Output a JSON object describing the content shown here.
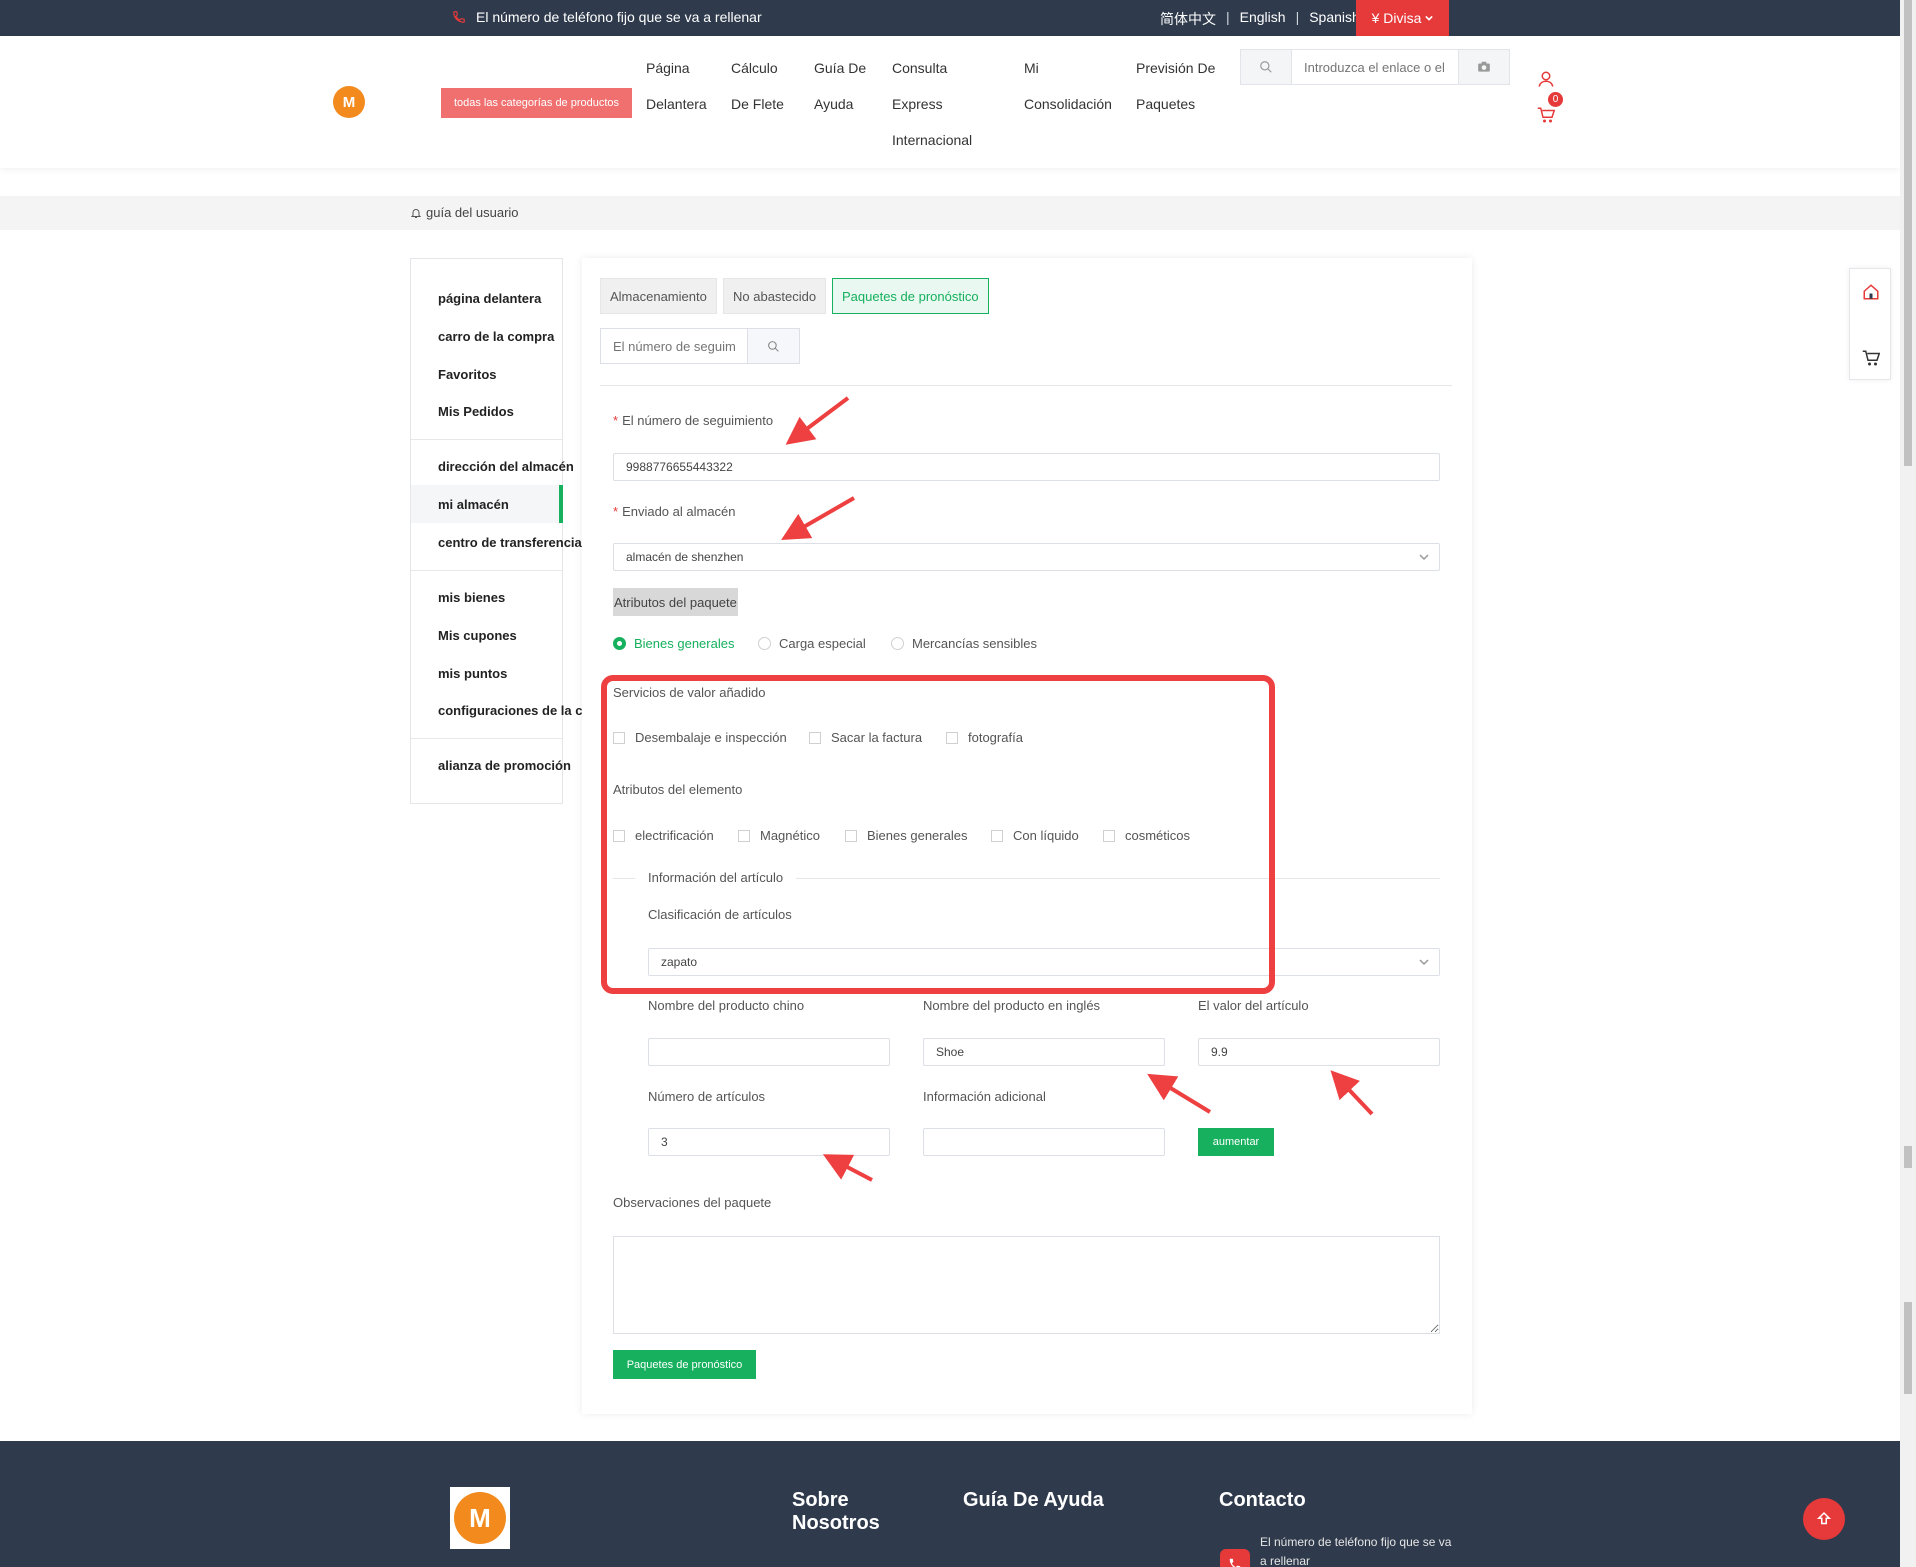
{
  "topbar": {
    "phone_text": "El número de teléfono fijo que se va a rellenar",
    "lang_zh": "简体中文",
    "lang_en": "English",
    "lang_es": "Spanish",
    "sep": "|",
    "currency_label": "¥ Divisa"
  },
  "header": {
    "categories_button": "todas las categorías de productos",
    "nav": [
      {
        "line1": "Página",
        "line2": "Delantera",
        "line3": ""
      },
      {
        "line1": "Cálculo",
        "line2": "De Flete",
        "line3": ""
      },
      {
        "line1": "Guía De",
        "line2": "Ayuda",
        "line3": ""
      },
      {
        "line1": "Consulta",
        "line2": "Express",
        "line3": "Internacional"
      },
      {
        "line1": "Mi",
        "line2": "Consolidación",
        "line3": ""
      },
      {
        "line1": "Previsión De",
        "line2": "Paquetes",
        "line3": ""
      }
    ],
    "search_placeholder": "Introduzca el enlace o el",
    "cart_count": "0",
    "logo_letter": "M"
  },
  "guide": {
    "label": "guía del usuario"
  },
  "sidebar": {
    "items": [
      "página delantera",
      "carro de la compra",
      "Favoritos",
      "Mis Pedidos",
      "dirección del almacén",
      "mi almacén",
      "centro de transferencia",
      "mis bienes",
      "Mis cupones",
      "mis puntos",
      "configuraciones de la cuenta",
      "alianza de promoción"
    ]
  },
  "tabs": [
    "Almacenamiento",
    "No abastecido",
    "Paquetes de pronóstico"
  ],
  "tracking_search_placeholder": "El número de seguim",
  "form": {
    "tracking_label": "El número de seguimiento",
    "tracking_value": "9988776655443322",
    "warehouse_label": "Enviado al almacén",
    "warehouse_value": "almacén de shenzhen",
    "package_attributes": "Atributos del paquete",
    "radios": [
      "Bienes generales",
      "Carga especial",
      "Mercancías sensibles"
    ],
    "value_added_label": "Servicios de valor añadido",
    "value_added": [
      "Desembalaje e inspección",
      "Sacar la factura",
      "fotografía"
    ],
    "element_attributes_label": "Atributos del elemento",
    "element_attributes": [
      "electrificación",
      "Magnético",
      "Bienes generales",
      "Con líquido",
      "cosméticos"
    ],
    "item_info_legend": "Información del artículo",
    "classification_label": "Clasificación de artículos",
    "classification_value": "zapato",
    "cn_name_label": "Nombre del producto chino",
    "cn_name_value": "",
    "en_name_label": "Nombre del producto en inglés",
    "en_name_value": "Shoe",
    "value_label": "El valor del artículo",
    "value_value": "9.9",
    "count_label": "Número de artículos",
    "count_value": "3",
    "extra_label": "Información adicional",
    "extra_value": "",
    "add_button": "aumentar",
    "remarks_label": "Observaciones del paquete",
    "submit_button": "Paquetes de pronóstico"
  },
  "footer": {
    "col1": "Sobre Nosotros",
    "col2": "Guía De Ayuda",
    "col3": "Contacto",
    "contact_text": "El número de teléfono fijo que se va a rellenar",
    "logo_letter": "M"
  },
  "colors": {
    "accent": "#16b05e",
    "brand_red": "#e5393a",
    "dark": "#2f3b4c",
    "highlight": "#ee4040"
  }
}
